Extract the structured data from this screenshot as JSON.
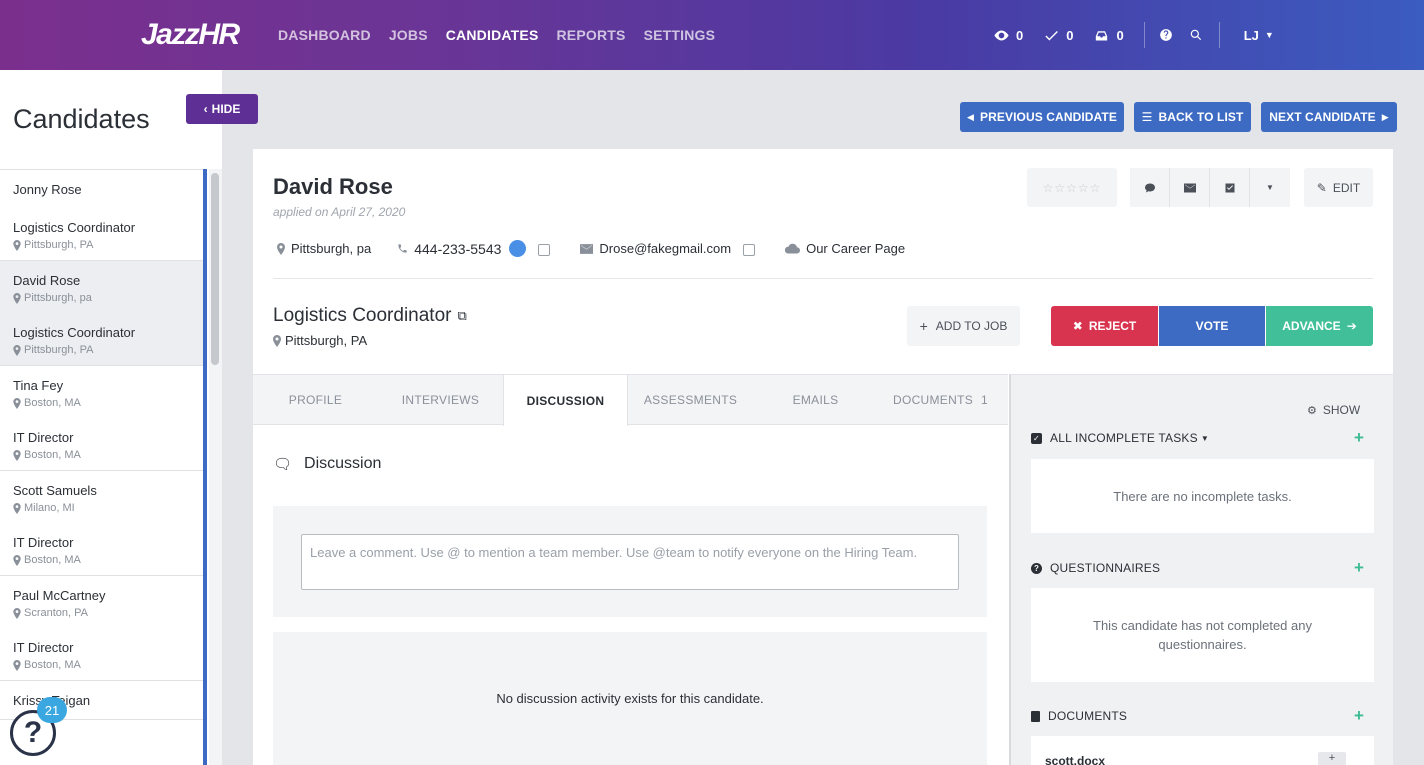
{
  "topbar": {
    "logo_main": "JazzHR",
    "nav": [
      {
        "label": "DASHBOARD",
        "active": false
      },
      {
        "label": "JOBS",
        "active": false
      },
      {
        "label": "CANDIDATES",
        "active": true
      },
      {
        "label": "REPORTS",
        "active": false
      },
      {
        "label": "SETTINGS",
        "active": false
      }
    ],
    "counters": {
      "views": "0",
      "checks": "0",
      "inbox": "0"
    },
    "user_initials": "LJ"
  },
  "sidebar": {
    "title": "Candidates",
    "hide_label": "HIDE",
    "help_badge": "21",
    "candidates": [
      {
        "name": "Jonny Rose",
        "name_loc": "",
        "job": "Logistics Coordinator",
        "job_loc": "Pittsburgh, PA",
        "selected": false
      },
      {
        "name": "David Rose",
        "name_loc": "Pittsburgh, pa",
        "job": "Logistics Coordinator",
        "job_loc": "Pittsburgh, PA",
        "selected": true
      },
      {
        "name": "Tina Fey",
        "name_loc": "Boston, MA",
        "job": "IT Director",
        "job_loc": "Boston, MA",
        "selected": false
      },
      {
        "name": "Scott Samuels",
        "name_loc": "Milano, MI",
        "job": "IT Director",
        "job_loc": "Boston, MA",
        "selected": false
      },
      {
        "name": "Paul McCartney",
        "name_loc": "Scranton, PA",
        "job": "IT Director",
        "job_loc": "Boston, MA",
        "selected": false
      },
      {
        "name": "Krissy Teigan",
        "name_loc": "",
        "job": "",
        "job_loc": "",
        "selected": false
      }
    ]
  },
  "candidate_nav": {
    "previous": "PREVIOUS CANDIDATE",
    "back": "BACK TO LIST",
    "next": "NEXT CANDIDATE"
  },
  "candidate": {
    "name": "David Rose",
    "applied": "applied on April 27, 2020",
    "location": "Pittsburgh, pa",
    "phone": "444-233-5543",
    "email": "Drose@fakegmail.com",
    "source": "Our Career Page",
    "edit_label": "EDIT"
  },
  "job": {
    "title": "Logistics Coordinator",
    "location": "Pittsburgh, PA",
    "add_to_job": "ADD TO JOB",
    "reject": "REJECT",
    "vote": "VOTE",
    "advance": "ADVANCE"
  },
  "tabs": [
    {
      "label": "PROFILE",
      "active": false,
      "count": ""
    },
    {
      "label": "INTERVIEWS",
      "active": false,
      "count": ""
    },
    {
      "label": "DISCUSSION",
      "active": true,
      "count": ""
    },
    {
      "label": "ASSESSMENTS",
      "active": false,
      "count": ""
    },
    {
      "label": "EMAILS",
      "active": false,
      "count": ""
    },
    {
      "label": "DOCUMENTS",
      "active": false,
      "count": "1"
    }
  ],
  "discussion": {
    "heading": "Discussion",
    "placeholder": "Leave a comment. Use @ to mention a team member. Use @team to notify everyone on the Hiring Team.",
    "empty": "No discussion activity exists for this candidate."
  },
  "right_panel": {
    "show": "SHOW",
    "tasks_title": "ALL INCOMPLETE TASKS",
    "tasks_empty": "There are no incomplete tasks.",
    "questionnaires_title": "QUESTIONNAIRES",
    "questionnaires_empty": "This candidate has not completed any questionnaires.",
    "documents_title": "DOCUMENTS",
    "document_name": "scott.docx",
    "document_button": "+"
  },
  "colors": {
    "brand_blue": "#3d6bc4",
    "reject": "#d9344f",
    "vote": "#3d6bc4",
    "advance": "#41bf98",
    "hide_purple": "#5e3096"
  }
}
